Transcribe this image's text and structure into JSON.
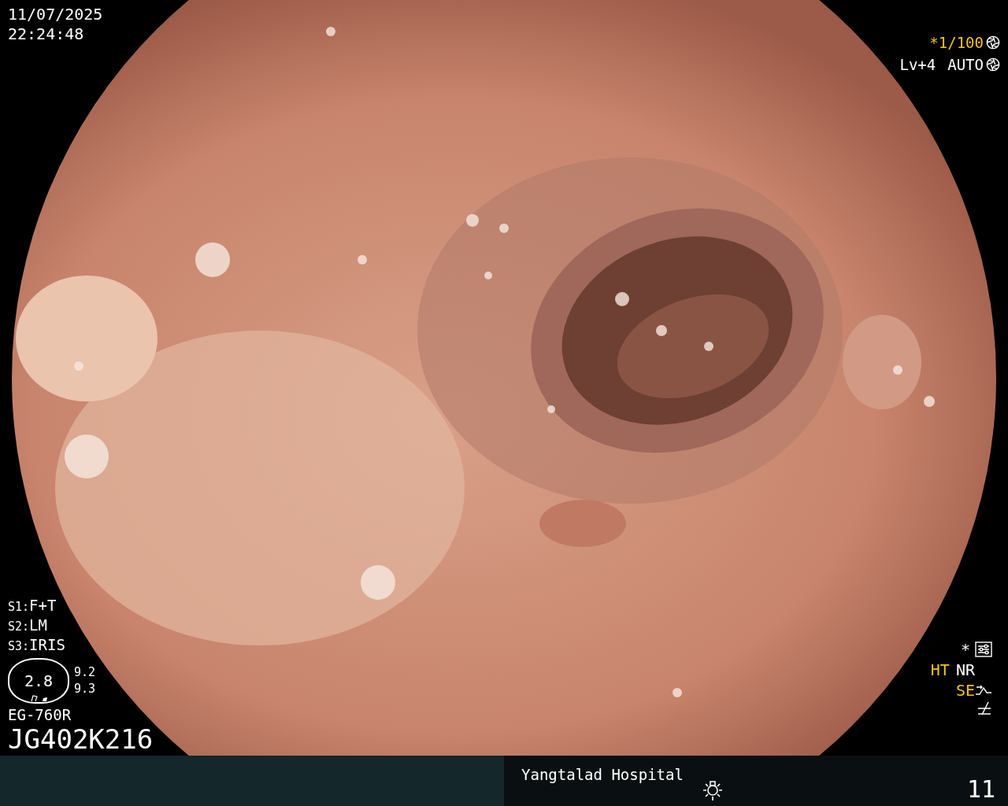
{
  "datetime": {
    "date": "11/07/2025",
    "time": "22:24:48"
  },
  "exposure": {
    "shutter": "*1/100",
    "level": "Lv+4",
    "mode": "AUTO"
  },
  "switches": [
    {
      "key": "S1:",
      "value": "F+T"
    },
    {
      "key": "S2:",
      "value": "LM"
    },
    {
      "key": "S3:",
      "value": "IRIS"
    }
  ],
  "zoom_gauge": {
    "value": "2.8",
    "readings": [
      "9.2",
      "9.3"
    ]
  },
  "scope": {
    "model": "EG-760R",
    "serial": "JG402K216"
  },
  "enhancement": {
    "mark": "*",
    "modes": [
      {
        "label": "HT",
        "active": true
      },
      {
        "label": "NR",
        "active": false
      }
    ],
    "structure": {
      "label": "SE",
      "active": true
    }
  },
  "footer": {
    "hospital": "Yangtalad Hospital",
    "counter": "11"
  }
}
